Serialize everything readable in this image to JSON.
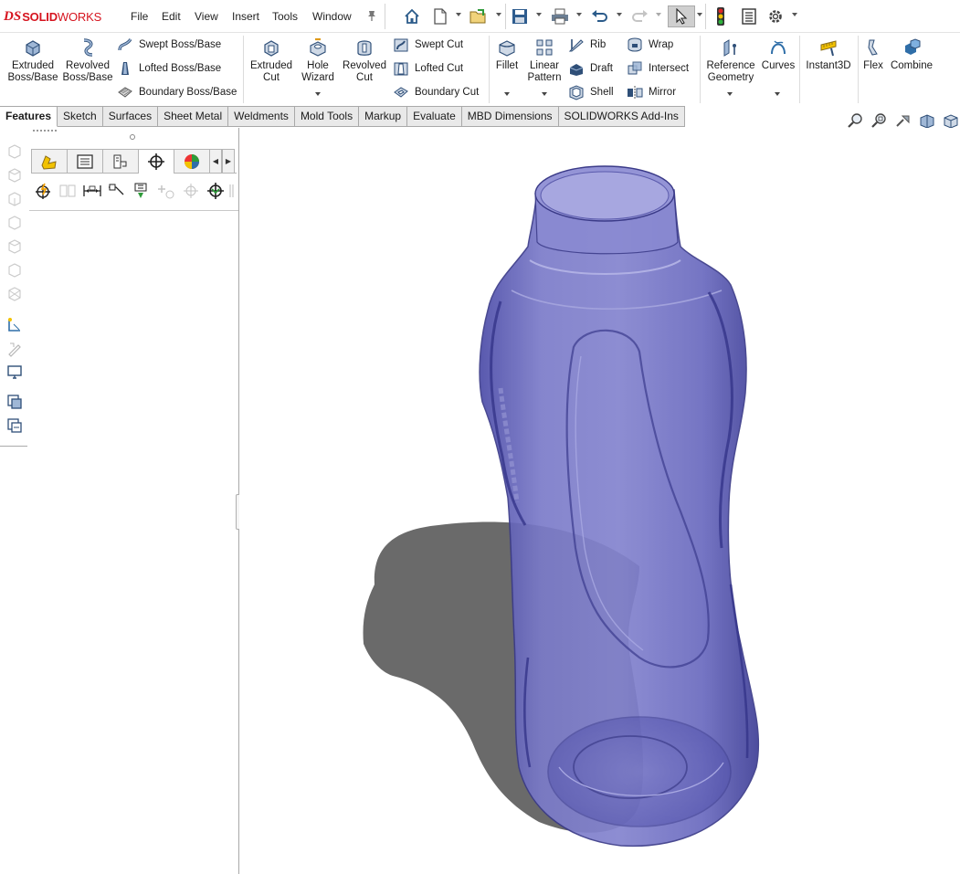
{
  "app": {
    "logo_ds": "DS",
    "logo_solid": "SOLID",
    "logo_works": "WORKS"
  },
  "menu": {
    "file": "File",
    "edit": "Edit",
    "view": "View",
    "insert": "Insert",
    "tools": "Tools",
    "window": "Window"
  },
  "quick_access": [
    "home-icon",
    "new-document-icon",
    "open-icon",
    "save-icon",
    "print-icon",
    "undo-icon",
    "redo-icon",
    "select-icon",
    "rebuild-icon",
    "file-properties-icon",
    "options-icon"
  ],
  "features": {
    "extruded_boss": "Extruded Boss/Base",
    "revolved_boss": "Revolved Boss/Base",
    "swept_boss": "Swept Boss/Base",
    "lofted_boss": "Lofted Boss/Base",
    "boundary_boss": "Boundary Boss/Base",
    "extruded_cut": "Extruded Cut",
    "hole_wizard": "Hole Wizard",
    "revolved_cut": "Revolved Cut",
    "swept_cut": "Swept Cut",
    "lofted_cut": "Lofted Cut",
    "boundary_cut": "Boundary Cut",
    "fillet": "Fillet",
    "linear_pattern": "Linear Pattern",
    "rib": "Rib",
    "draft": "Draft",
    "shell": "Shell",
    "wrap": "Wrap",
    "intersect": "Intersect",
    "mirror": "Mirror",
    "reference_geometry": "Reference Geometry",
    "curves": "Curves",
    "instant3d": "Instant3D",
    "flex": "Flex",
    "combine": "Combine"
  },
  "features_split": {
    "extruded_boss": [
      "Extruded",
      "Boss/Base"
    ],
    "revolved_boss": [
      "Revolved",
      "Boss/Base"
    ],
    "extruded_cut": [
      "Extruded",
      "Cut"
    ],
    "hole_wizard": [
      "Hole",
      "Wizard"
    ],
    "revolved_cut": [
      "Revolved",
      "Cut"
    ],
    "linear_pattern": [
      "Linear",
      "Pattern"
    ],
    "reference_geometry": [
      "Reference",
      "Geometry"
    ]
  },
  "tabs": [
    "Features",
    "Sketch",
    "Surfaces",
    "Sheet Metal",
    "Weldments",
    "Mold Tools",
    "Markup",
    "Evaluate",
    "MBD Dimensions",
    "SOLIDWORKS Add-Ins"
  ],
  "active_tab": "Features",
  "colors": {
    "accent_red": "#d6141f",
    "bottle": "#5a5ab4",
    "shadow": "#5a5a5a"
  }
}
